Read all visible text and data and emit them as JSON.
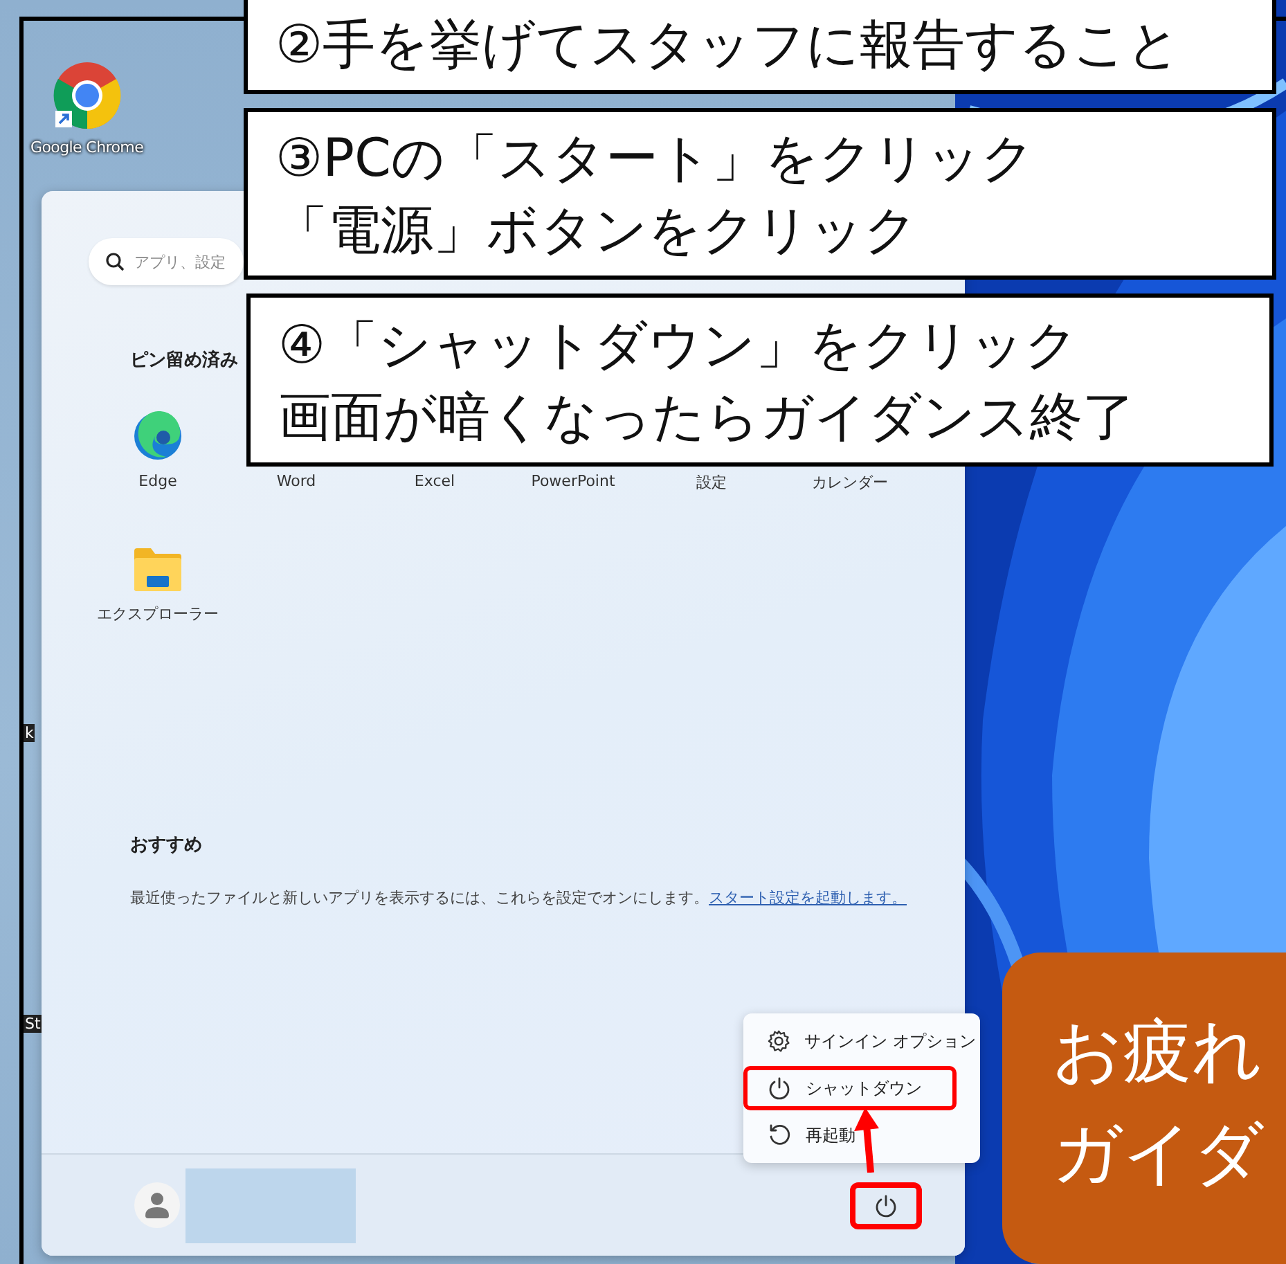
{
  "desktop": {
    "icons": [
      {
        "label": "Google Chrome",
        "kind": "chrome"
      },
      {
        "label": "k",
        "kind": "cut"
      },
      {
        "label": "St",
        "kind": "cut"
      }
    ]
  },
  "start_menu": {
    "search": {
      "placeholder": "アプリ、設定"
    },
    "pinned_title": "ピン留め済み",
    "pinned": [
      {
        "label": "Edge",
        "kind": "edge"
      },
      {
        "label": "Word",
        "kind": "covered"
      },
      {
        "label": "Excel",
        "kind": "covered"
      },
      {
        "label": "PowerPoint",
        "kind": "covered"
      },
      {
        "label": "設定",
        "kind": "covered"
      },
      {
        "label": "カレンダー",
        "kind": "covered"
      },
      {
        "label": "エクスプローラー",
        "kind": "explorer"
      }
    ],
    "recommended": {
      "title": "おすすめ",
      "text": "最近使ったファイルと新しいアプリを表示するには、これらを設定でオンにします。",
      "link": "スタート設定を起動します。"
    },
    "power_button": {
      "annotated": true
    }
  },
  "power_menu": [
    {
      "label": "サインイン オプション",
      "kind": "gear",
      "annotated": false
    },
    {
      "label": "シャットダウン",
      "kind": "power",
      "annotated": true
    },
    {
      "label": "再起動",
      "kind": "restart",
      "annotated": false
    }
  ],
  "callouts": [
    {
      "kind": "box",
      "lines": [
        "②手を挙げてスタッフに報告すること"
      ]
    },
    {
      "kind": "box",
      "lines": [
        "③PCの「スタート」をクリック",
        "「電源」ボタンをクリック"
      ]
    },
    {
      "kind": "box",
      "lines": [
        "④「シャットダウン」をクリック",
        "画面が暗くなったらガイダンス終了"
      ]
    },
    {
      "kind": "banner",
      "lines": [
        "お疲れ",
        "ガイダ"
      ]
    }
  ]
}
